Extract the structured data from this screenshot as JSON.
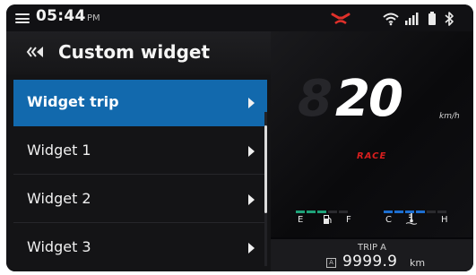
{
  "status_bar": {
    "time": "05:44",
    "ampm": "PM",
    "icons": [
      "menu-icon",
      "motorcycle-alert-icon",
      "wifi-icon",
      "signal-icon",
      "battery-icon",
      "bluetooth-icon"
    ]
  },
  "panel": {
    "title": "Custom widget",
    "items": [
      {
        "label": "Widget trip",
        "selected": true
      },
      {
        "label": "Widget 1",
        "selected": false
      },
      {
        "label": "Widget 2",
        "selected": false
      },
      {
        "label": "Widget 3",
        "selected": false
      }
    ]
  },
  "dashboard": {
    "speed": "20",
    "speed_unit": "km/h",
    "ride_mode": "RACE",
    "fuel_labels": {
      "empty": "E",
      "full": "F"
    },
    "temp_labels": {
      "cold": "C",
      "hot": "H"
    },
    "trip": {
      "title": "TRIP A",
      "badge": "A",
      "value": "9999.9",
      "unit": "km"
    }
  },
  "colors": {
    "accent": "#1269ad",
    "mode_red": "#d81e1e",
    "fuel_green": "#1fa37a",
    "temp_blue": "#1d6fd1"
  }
}
